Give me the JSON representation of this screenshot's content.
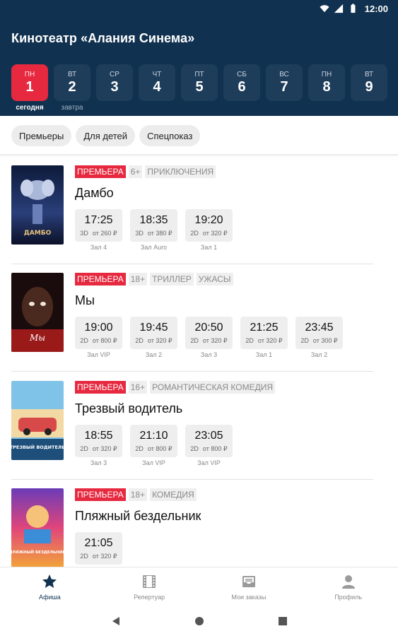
{
  "status_bar": {
    "time": "12:00"
  },
  "header": {
    "title": "Кинотеатр «Алания Синема»"
  },
  "dates": [
    {
      "weekday": "пн",
      "day": "1",
      "note": "сегодня",
      "active": true
    },
    {
      "weekday": "вт",
      "day": "2",
      "note": "завтра"
    },
    {
      "weekday": "ср",
      "day": "3"
    },
    {
      "weekday": "чт",
      "day": "4"
    },
    {
      "weekday": "пт",
      "day": "5"
    },
    {
      "weekday": "сб",
      "day": "6"
    },
    {
      "weekday": "вс",
      "day": "7"
    },
    {
      "weekday": "пн",
      "day": "8"
    },
    {
      "weekday": "вт",
      "day": "9"
    }
  ],
  "filters": [
    "Премьеры",
    "Для детей",
    "Спецпоказ"
  ],
  "movies": [
    {
      "title": "Дамбо",
      "tags": [
        "ПРЕМЬЕРА",
        "6+",
        "ПРИКЛЮЧЕНИЯ"
      ],
      "poster_text": "ДАМБО",
      "sessions": [
        {
          "time": "17:25",
          "format": "3D",
          "price": "от 260 ₽",
          "hall": "Зал 4"
        },
        {
          "time": "18:35",
          "format": "3D",
          "price": "от 380 ₽",
          "hall": "Зал Auro"
        },
        {
          "time": "19:20",
          "format": "2D",
          "price": "от 320 ₽",
          "hall": "Зал 1"
        }
      ]
    },
    {
      "title": "Мы",
      "tags": [
        "ПРЕМЬЕРА",
        "18+",
        "ТРИЛЛЕР",
        "УЖАСЫ"
      ],
      "poster_text": "Мы",
      "sessions": [
        {
          "time": "19:00",
          "format": "2D",
          "price": "от 800 ₽",
          "hall": "Зал VIP"
        },
        {
          "time": "19:45",
          "format": "2D",
          "price": "от 320 ₽",
          "hall": "Зал 2"
        },
        {
          "time": "20:50",
          "format": "2D",
          "price": "от 320 ₽",
          "hall": "Зал 3"
        },
        {
          "time": "21:25",
          "format": "2D",
          "price": "от 320 ₽",
          "hall": "Зал 1"
        },
        {
          "time": "23:45",
          "format": "2D",
          "price": "от 300 ₽",
          "hall": "Зал 2"
        }
      ]
    },
    {
      "title": "Трезвый водитель",
      "tags": [
        "ПРЕМЬЕРА",
        "16+",
        "РОМАНТИЧЕСКАЯ КОМЕДИЯ"
      ],
      "poster_text": "ТРЕЗВЫЙ ВОДИТЕЛЬ",
      "sessions": [
        {
          "time": "18:55",
          "format": "2D",
          "price": "от 320 ₽",
          "hall": "Зал 3"
        },
        {
          "time": "21:10",
          "format": "2D",
          "price": "от 800 ₽",
          "hall": "Зал VIP"
        },
        {
          "time": "23:05",
          "format": "2D",
          "price": "от 800 ₽",
          "hall": "Зал VIP"
        }
      ]
    },
    {
      "title": "Пляжный бездельник",
      "tags": [
        "ПРЕМЬЕРА",
        "18+",
        "КОМЕДИЯ"
      ],
      "poster_text": "ПЛЯЖНЫЙ БЕЗДЕЛЬНИК",
      "sessions": [
        {
          "time": "21:05",
          "format": "2D",
          "price": "от 320 ₽",
          "hall": ""
        }
      ]
    }
  ],
  "bottom_nav": [
    {
      "label": "Афиша",
      "icon": "star-icon",
      "active": true
    },
    {
      "label": "Репертуар",
      "icon": "film-icon"
    },
    {
      "label": "Мои заказы",
      "icon": "inbox-icon"
    },
    {
      "label": "Профиль",
      "icon": "person-icon"
    }
  ],
  "colors": {
    "header_bg": "#10314f",
    "accent": "#e7293f",
    "chip_bg": "#ececec"
  }
}
